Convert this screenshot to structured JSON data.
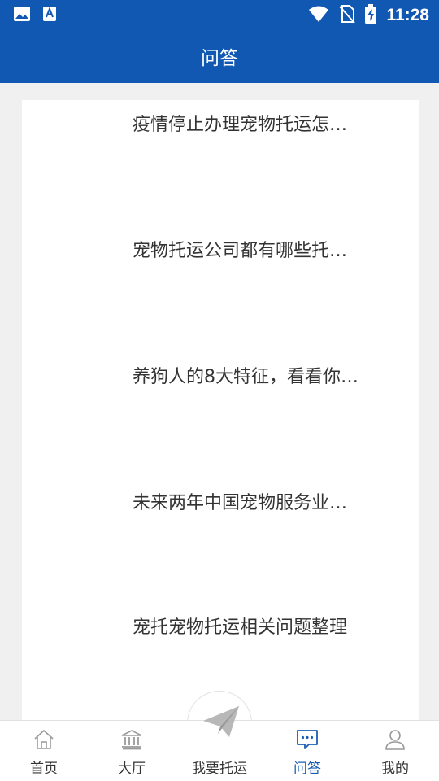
{
  "status": {
    "time": "11:28",
    "icons": [
      "image-icon",
      "text-a-icon",
      "wifi-icon",
      "no-sim-icon",
      "battery-charging-icon"
    ]
  },
  "header": {
    "title": "问答"
  },
  "qa": {
    "items": [
      {
        "title": "疫情停止办理宠物托运怎…"
      },
      {
        "title": "宠物托运公司都有哪些托…"
      },
      {
        "title": "养狗人的8大特征，看看你…"
      },
      {
        "title": "未来两年中国宠物服务业…"
      },
      {
        "title": "宠托宠物托运相关问题整理"
      }
    ]
  },
  "tabbar": {
    "active": "问答",
    "accent": "#1a5fb4",
    "tabs": [
      {
        "label": "首页",
        "icon": "home-icon"
      },
      {
        "label": "大厅",
        "icon": "bank-icon"
      },
      {
        "label": "我要托运",
        "icon": "send-icon"
      },
      {
        "label": "问答",
        "icon": "chat-icon"
      },
      {
        "label": "我的",
        "icon": "user-icon"
      }
    ]
  },
  "colors": {
    "header_bg": "#1158b3",
    "page_bg": "#f0f0f0"
  }
}
